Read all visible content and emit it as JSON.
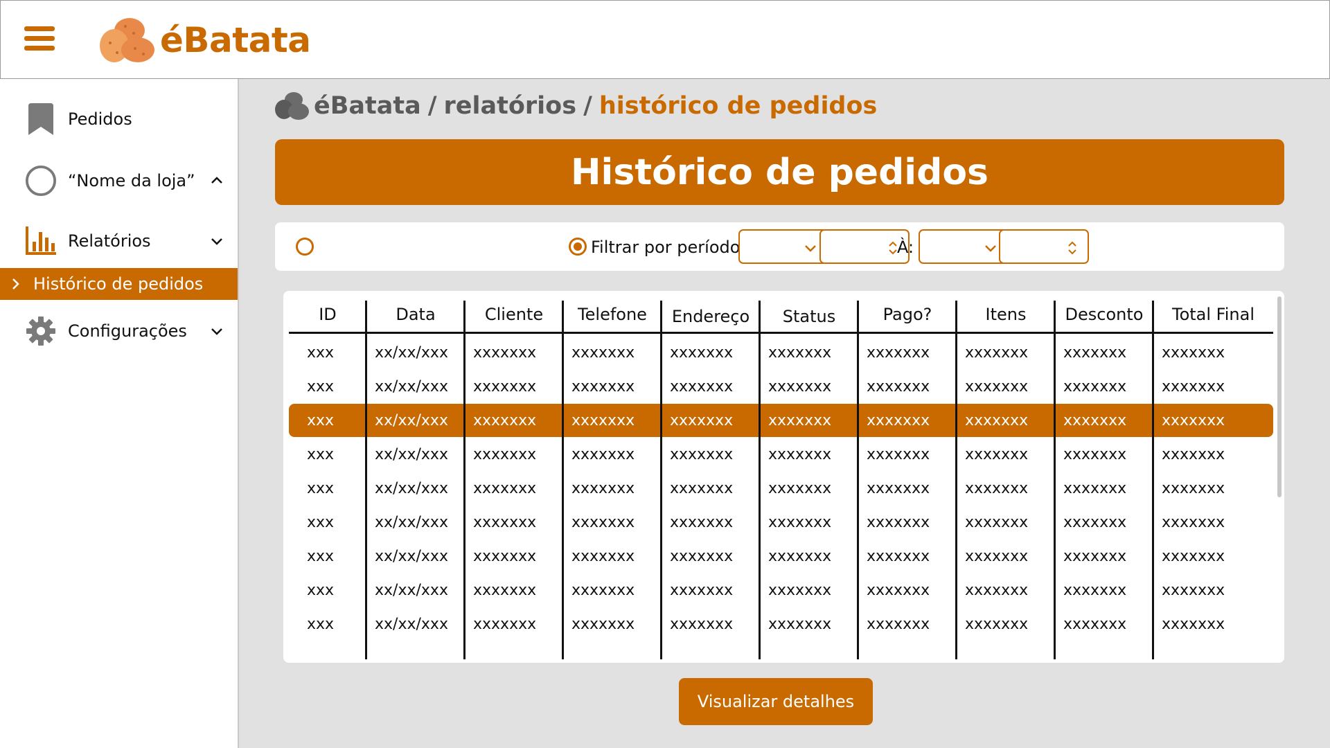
{
  "app": {
    "name": "éBatata"
  },
  "sidebar": {
    "items": [
      {
        "label": "Pedidos",
        "icon": "bookmark-icon"
      },
      {
        "label": "“Nome da loja”",
        "icon": "store-avatar-icon",
        "chevron": "up"
      },
      {
        "label": "Relatórios",
        "icon": "bar-chart-icon",
        "chevron": "down"
      },
      {
        "label": "Configurações",
        "icon": "gear-icon",
        "chevron": "down"
      }
    ],
    "active_sub": "Histórico de pedidos"
  },
  "breadcrumb": {
    "root": "éBatata",
    "sep1": "/",
    "section": "relatórios",
    "sep2": "/",
    "current": "histórico de pedidos"
  },
  "page_title": "Histórico de pedidos",
  "filters": {
    "period_label": "Filtrar por período de:",
    "to_label": "À:"
  },
  "table": {
    "headers": [
      "ID",
      "Data",
      "Cliente",
      "Telefone",
      "Endereço",
      "Status",
      "Pago?",
      "Itens",
      "Desconto",
      "Total Final"
    ],
    "rows": [
      [
        "xxx",
        "xx/xx/xxx",
        "xxxxxxx",
        "xxxxxxx",
        "xxxxxxx",
        "xxxxxxx",
        "xxxxxxx",
        "xxxxxxx",
        "xxxxxxx",
        "xxxxxxx"
      ],
      [
        "xxx",
        "xx/xx/xxx",
        "xxxxxxx",
        "xxxxxxx",
        "xxxxxxx",
        "xxxxxxx",
        "xxxxxxx",
        "xxxxxxx",
        "xxxxxxx",
        "xxxxxxx"
      ],
      [
        "xxx",
        "xx/xx/xxx",
        "xxxxxxx",
        "xxxxxxx",
        "xxxxxxx",
        "xxxxxxx",
        "xxxxxxx",
        "xxxxxxx",
        "xxxxxxx",
        "xxxxxxx"
      ],
      [
        "xxx",
        "xx/xx/xxx",
        "xxxxxxx",
        "xxxxxxx",
        "xxxxxxx",
        "xxxxxxx",
        "xxxxxxx",
        "xxxxxxx",
        "xxxxxxx",
        "xxxxxxx"
      ],
      [
        "xxx",
        "xx/xx/xxx",
        "xxxxxxx",
        "xxxxxxx",
        "xxxxxxx",
        "xxxxxxx",
        "xxxxxxx",
        "xxxxxxx",
        "xxxxxxx",
        "xxxxxxx"
      ],
      [
        "xxx",
        "xx/xx/xxx",
        "xxxxxxx",
        "xxxxxxx",
        "xxxxxxx",
        "xxxxxxx",
        "xxxxxxx",
        "xxxxxxx",
        "xxxxxxx",
        "xxxxxxx"
      ],
      [
        "xxx",
        "xx/xx/xxx",
        "xxxxxxx",
        "xxxxxxx",
        "xxxxxxx",
        "xxxxxxx",
        "xxxxxxx",
        "xxxxxxx",
        "xxxxxxx",
        "xxxxxxx"
      ],
      [
        "xxx",
        "xx/xx/xxx",
        "xxxxxxx",
        "xxxxxxx",
        "xxxxxxx",
        "xxxxxxx",
        "xxxxxxx",
        "xxxxxxx",
        "xxxxxxx",
        "xxxxxxx"
      ],
      [
        "xxx",
        "xx/xx/xxx",
        "xxxxxxx",
        "xxxxxxx",
        "xxxxxxx",
        "xxxxxxx",
        "xxxxxxx",
        "xxxxxxx",
        "xxxxxxx",
        "xxxxxxx"
      ]
    ],
    "selected_row": 2
  },
  "actions": {
    "details_button": "Visualizar detalhes"
  },
  "colors": {
    "accent": "#c96a00",
    "background": "#e1e1e1",
    "surface": "#ffffff",
    "muted_icon": "#7a7a7a"
  }
}
